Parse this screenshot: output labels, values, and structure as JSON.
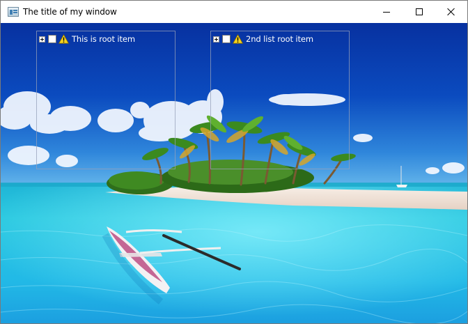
{
  "window": {
    "title": "The title of my window",
    "controls": {
      "minimize": "minimize",
      "maximize": "maximize",
      "close": "close"
    }
  },
  "trees": [
    {
      "root_label": "This is root item",
      "expanded": false,
      "checked": false,
      "icon": "warning-icon"
    },
    {
      "root_label": "2nd list root item",
      "expanded": false,
      "checked": false,
      "icon": "warning-icon"
    }
  ],
  "background": {
    "subject": "tropical island beach with palm trees, turquoise water and an outrigger canoe",
    "colors": {
      "sky_top": "#0a3aa8",
      "sky_horizon": "#3a8ee0",
      "sea": "#1fc4d8",
      "sand": "#f1e6dc",
      "palm": "#2f7a1c"
    }
  }
}
